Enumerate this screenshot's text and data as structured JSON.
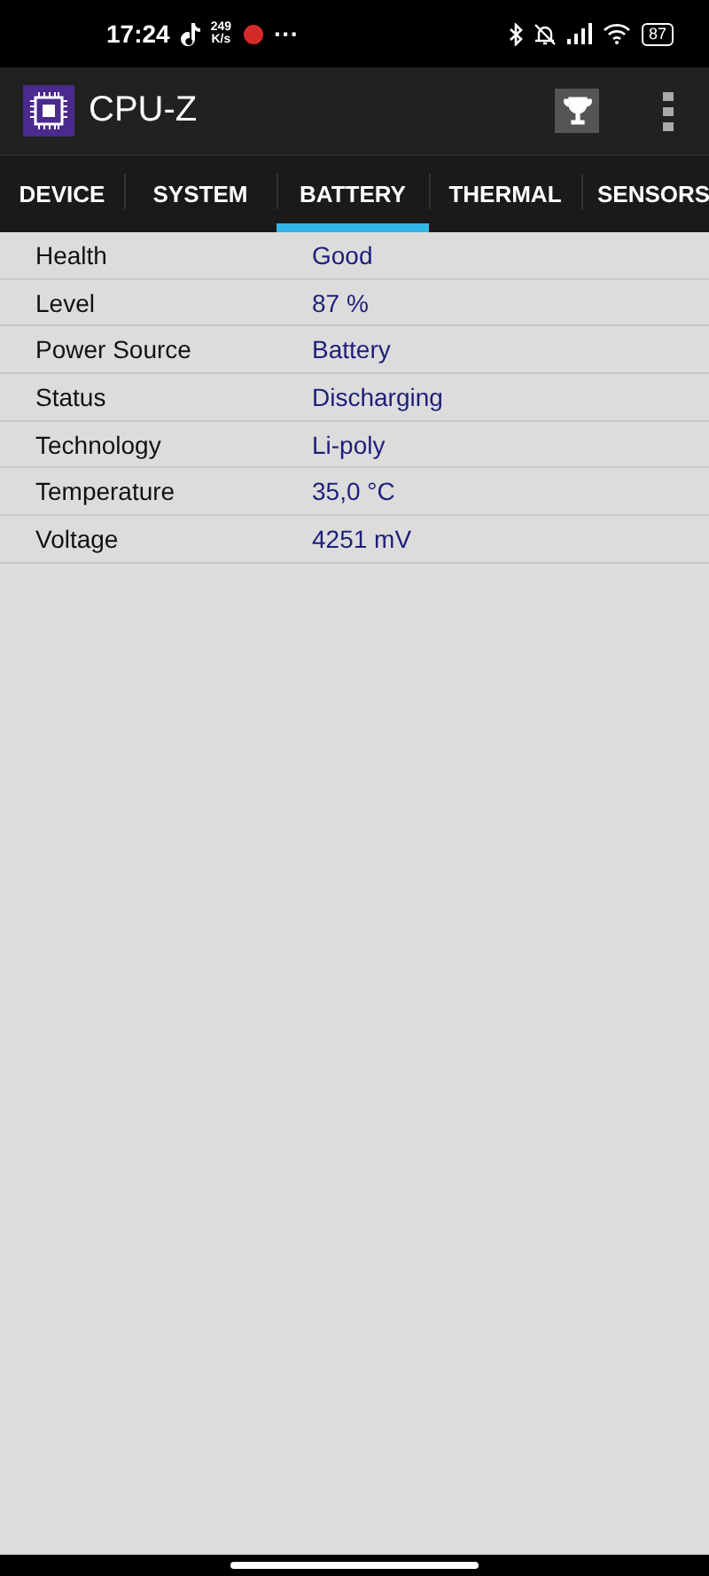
{
  "status_bar": {
    "time": "17:24",
    "speed_value": "249",
    "speed_unit": "K/s",
    "more": "···",
    "battery": "87"
  },
  "app_bar": {
    "title": "CPU-Z"
  },
  "tabs": [
    {
      "label": "DEVICE",
      "selected": false
    },
    {
      "label": "SYSTEM",
      "selected": false
    },
    {
      "label": "BATTERY",
      "selected": true
    },
    {
      "label": "THERMAL",
      "selected": false
    },
    {
      "label": "SENSORS",
      "selected": false
    }
  ],
  "rows": [
    {
      "label": "Health",
      "value": "Good"
    },
    {
      "label": "Level",
      "value": "87 %"
    },
    {
      "label": "Power Source",
      "value": "Battery"
    },
    {
      "label": "Status",
      "value": "Discharging"
    },
    {
      "label": "Technology",
      "value": "Li-poly"
    },
    {
      "label": "Temperature",
      "value": "35,0 °C"
    },
    {
      "label": "Voltage",
      "value": "4251 mV"
    }
  ]
}
